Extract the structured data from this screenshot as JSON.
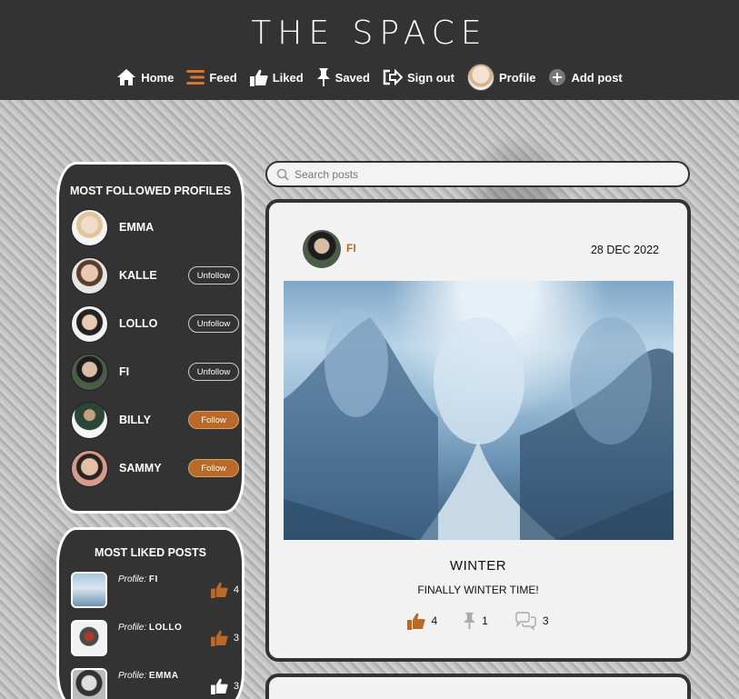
{
  "app": {
    "logo": "THE SPACE"
  },
  "nav": {
    "home": "Home",
    "feed": "Feed",
    "liked": "Liked",
    "saved": "Saved",
    "signout": "Sign out",
    "profile": "Profile",
    "addpost": "Add post"
  },
  "most_followed": {
    "title": "MOST FOLLOWED PROFILES",
    "profiles": [
      {
        "name": "EMMA",
        "button": ""
      },
      {
        "name": "KALLE",
        "button": "Unfollow"
      },
      {
        "name": "LOLLO",
        "button": "Unfollow"
      },
      {
        "name": "FI",
        "button": "Unfollow"
      },
      {
        "name": "BILLY",
        "button": "Follow"
      },
      {
        "name": "SAMMY",
        "button": "Follow"
      }
    ]
  },
  "most_liked": {
    "title": "MOST LIKED POSTS",
    "profile_prefix": "Profile:",
    "posts": [
      {
        "profile": "FI",
        "likes": "4"
      },
      {
        "profile": "LOLLO",
        "likes": "3"
      },
      {
        "profile": "EMMA",
        "likes": "3"
      }
    ]
  },
  "search": {
    "placeholder": "Search posts"
  },
  "post": {
    "author": "FI",
    "date": "28 DEC 2022",
    "title": "WINTER",
    "body": "FINALLY WINTER TIME!",
    "likes": "4",
    "saves": "1",
    "comments": "3"
  },
  "colors": {
    "header_bg": "#333333",
    "accent": "#b9692a",
    "card_bg": "#333333"
  }
}
